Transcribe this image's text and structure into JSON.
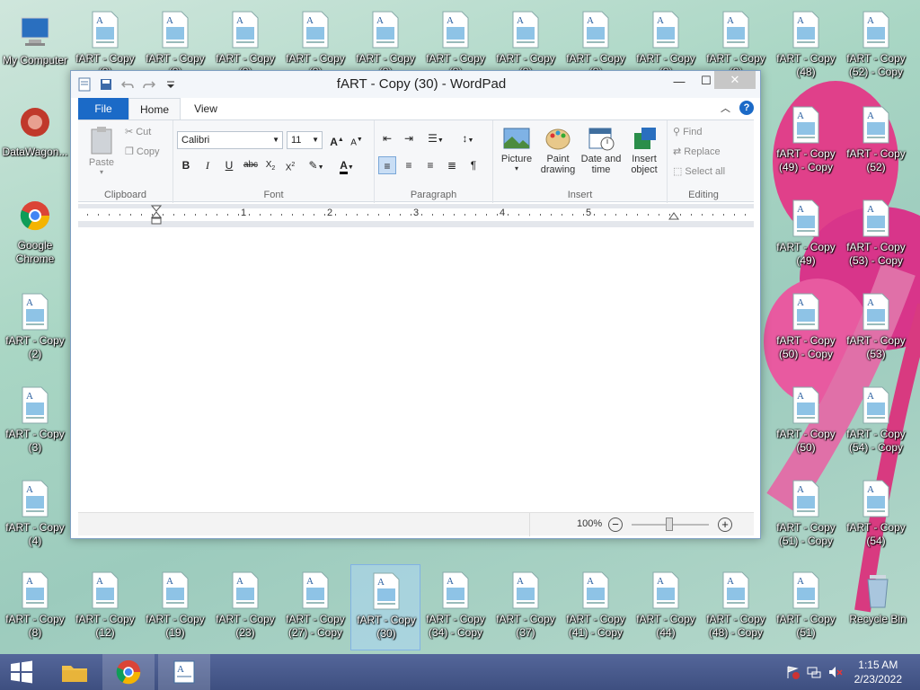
{
  "desktop": {
    "icons": [
      {
        "name": "my-computer-icon",
        "label": "My Computer"
      },
      {
        "name": "datawagon-icon",
        "label": "DataWagon..."
      },
      {
        "name": "google-chrome-desktop-icon",
        "label": "Google Chrome"
      },
      {
        "name": "recycle-bin-icon",
        "label": "Recycle Bin"
      }
    ],
    "files": {
      "top_row": [
        "fART - Copy (?)",
        "fART - Copy (?)",
        "fART - Copy (?)",
        "fART - Copy (?)",
        "fART - Copy (?)",
        "fART - Copy (?)",
        "fART - Copy (?)",
        "fART - Copy (?)",
        "fART - Copy (?)",
        "fART - Copy (?)",
        "fART - Copy (48)",
        "fART - Copy (52) - Copy"
      ],
      "left_col": [
        "fART - Copy (2)",
        "fART - Copy (3)",
        "fART - Copy (4)"
      ],
      "right_col_a": [
        "fART - Copy (49) - Copy",
        "fART - Copy (49)",
        "fART - Copy (50) - Copy",
        "fART - Copy (50)",
        "fART - Copy (51) - Copy"
      ],
      "right_col_b": [
        "fART - Copy (52)",
        "fART - Copy (53) - Copy",
        "fART - Copy (53)",
        "fART - Copy (54) - Copy",
        "fART - Copy (54)"
      ],
      "bottom_row": [
        "fART - Copy (8)",
        "fART - Copy (12)",
        "fART - Copy (19)",
        "fART - Copy (23)",
        "fART - Copy (27) - Copy",
        "fART - Copy (30)",
        "fART - Copy (34) - Copy",
        "fART - Copy (37)",
        "fART - Copy (41) - Copy",
        "fART - Copy (44)",
        "fART - Copy (48) - Copy",
        "fART - Copy (51)"
      ]
    }
  },
  "window": {
    "title": "fART - Copy (30) - WordPad",
    "tabs": {
      "file": "File",
      "home": "Home",
      "view": "View"
    },
    "clipboard": {
      "paste": "Paste",
      "cut": "Cut",
      "copy": "Copy",
      "group": "Clipboard"
    },
    "font": {
      "family": "Calibri",
      "size": "11",
      "group": "Font"
    },
    "paragraph": {
      "group": "Paragraph"
    },
    "insert": {
      "picture": "Picture",
      "paint1": "Paint",
      "paint2": "drawing",
      "date1": "Date and",
      "date2": "time",
      "obj1": "Insert",
      "obj2": "object",
      "group": "Insert"
    },
    "editing": {
      "find": "Find",
      "replace": "Replace",
      "select_all": "Select all",
      "group": "Editing"
    },
    "ruler": [
      "1",
      "2",
      "3",
      "4",
      "5"
    ],
    "status": {
      "zoom": "100%"
    }
  },
  "taskbar": {
    "time": "1:15 AM",
    "date": "2/23/2022"
  },
  "colors": {
    "accent": "#1b6ac7",
    "taskbar": "#4a5b8a"
  }
}
